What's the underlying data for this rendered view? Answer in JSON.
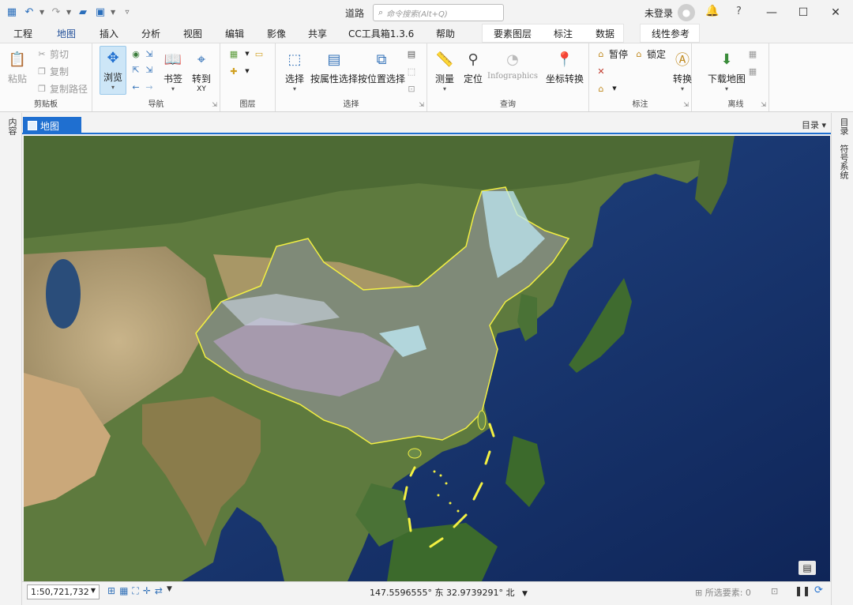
{
  "title_bar": {
    "doc_title": "道路",
    "search_placeholder": "命令搜索(Alt+Q)",
    "signin": "未登录"
  },
  "tabs": [
    "工程",
    "地图",
    "插入",
    "分析",
    "视图",
    "编辑",
    "影像",
    "共享",
    "CC工具箱1.3.6",
    "帮助"
  ],
  "active_tab": "地图",
  "context_tabs": [
    "要素图层",
    "标注",
    "数据"
  ],
  "context_tab2": "线性参考",
  "ribbon": {
    "clipboard": {
      "paste": "粘贴",
      "cut": "剪切",
      "copy": "复制",
      "copy_path": "复制路径",
      "label": "剪贴板"
    },
    "navigate": {
      "explore": "浏览",
      "bookmarks": "书签",
      "goto_xy": "转到",
      "goto_xy_sub": "XY",
      "label": "导航"
    },
    "layer": {
      "label": "图层"
    },
    "selection": {
      "select": "选择",
      "by_attr": "按属性选择",
      "by_location": "按位置选择",
      "label": "选择"
    },
    "inquiry": {
      "measure": "测量",
      "locate": "定位",
      "infographics": "Infographics",
      "convert_coords": "坐标转换",
      "label": "查询"
    },
    "labeling": {
      "pause": "暂停",
      "lock": "锁定",
      "convert": "转换",
      "label": "标注"
    },
    "offline": {
      "download_map": "下载地图",
      "label": "离线"
    }
  },
  "left_panel": "内容",
  "right_panel_1": "目录",
  "right_panel_2": "符号系统",
  "map_tab": "地图",
  "map_menu": "目录",
  "status": {
    "scale": "1:50,721,732",
    "coordinates": "147.5596555° 东 32.9739291° 北",
    "selected_features": "所选要素: 0"
  },
  "colors": {
    "accent": "#1f6fd0",
    "boundary": "#f3f042",
    "glacier": "#bfe8f5"
  }
}
